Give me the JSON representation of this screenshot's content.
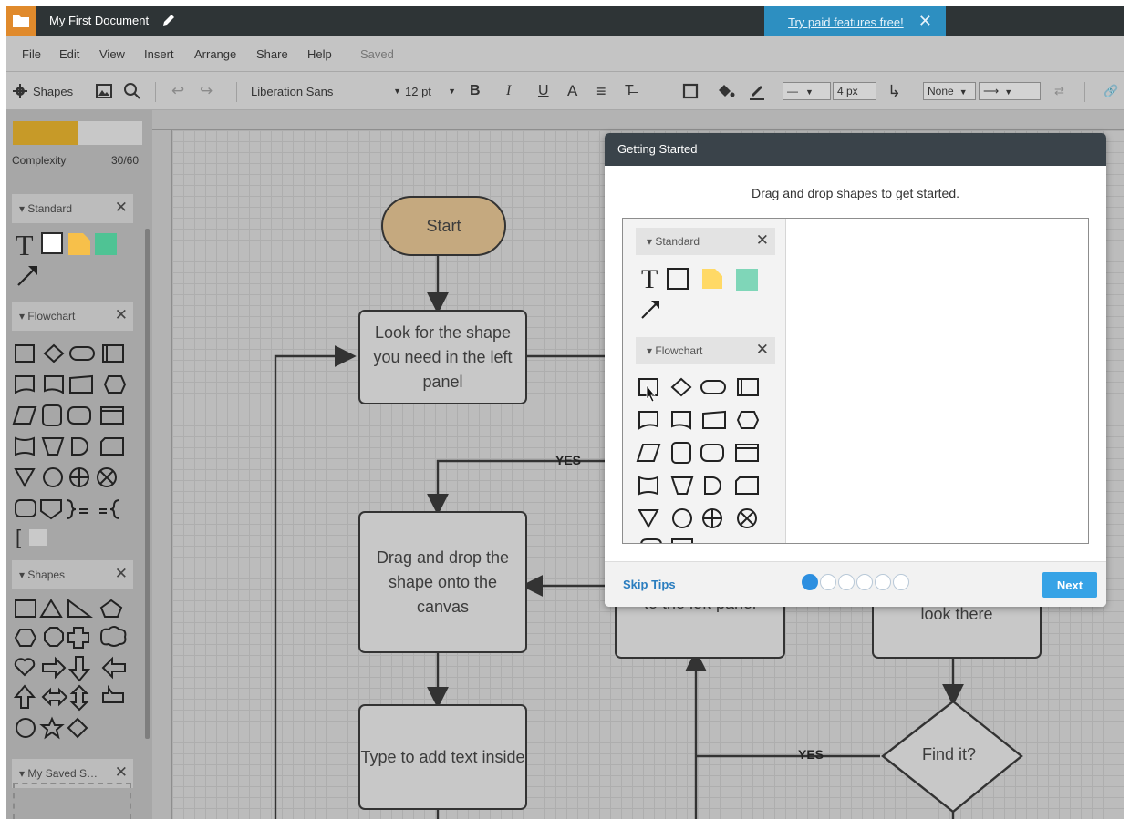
{
  "app": {
    "doc_title": "My First Document",
    "promo": "Try paid features free!",
    "promo_close": "✕"
  },
  "menu": {
    "items": [
      "File",
      "Edit",
      "View",
      "Insert",
      "Arrange",
      "Share",
      "Help"
    ],
    "status": "Saved"
  },
  "toolbar": {
    "shapes_label": "Shapes",
    "font": "Liberation Sans",
    "font_size": "12 pt",
    "bold": "B",
    "italic": "I",
    "underline": "U",
    "color_a": "A",
    "align": "≡",
    "text_opts": "T̶",
    "line_width": "4 px",
    "line_end": "None"
  },
  "left_panel": {
    "complexity_label": "Complexity",
    "complexity_value": "30/60",
    "complexity_fraction": 0.5,
    "sections": {
      "standard": "Standard",
      "flowchart": "Flowchart",
      "shapes": "Shapes",
      "saved": "My Saved S…"
    },
    "close_glyph": "✕"
  },
  "canvas": {
    "start": "Start",
    "look": "Look for the shape you need in the left panel",
    "drag": "Drag and drop the shape onto the canvas",
    "type": "Type to add text inside",
    "left_panel_partial": "to the left panel",
    "look_there": "look there",
    "find": "Find it?",
    "yes": "YES"
  },
  "dialog": {
    "title": "Getting Started",
    "subtitle": "Drag and drop shapes to get started.",
    "preview_standard": "Standard",
    "preview_flowchart": "Flowchart",
    "skip": "Skip Tips",
    "next": "Next",
    "steps": 6,
    "current_step": 1
  },
  "colors": {
    "accent": "#2d8fc1",
    "start_fill": "#c5a97f",
    "complexity": "#c79a28",
    "note_yellow": "#ffd966",
    "teal": "#7fd6b8"
  }
}
